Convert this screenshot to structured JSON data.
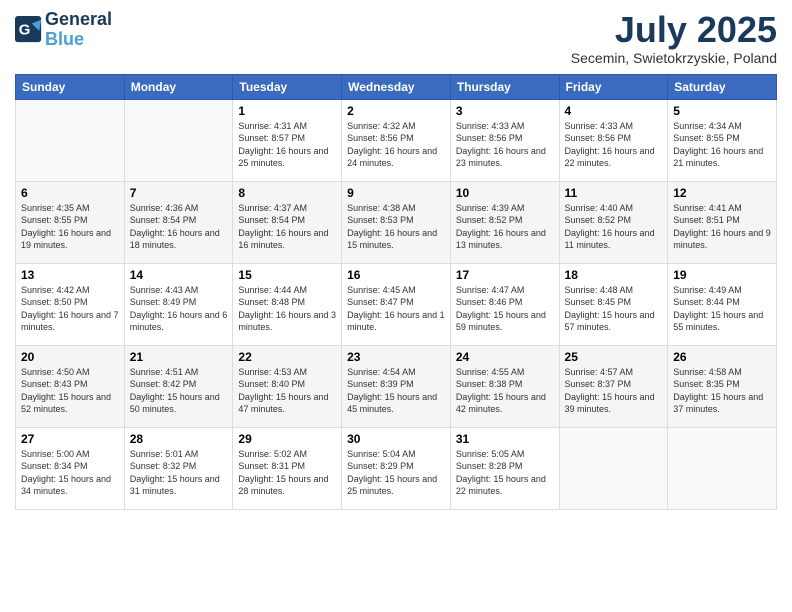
{
  "header": {
    "logo_line1": "General",
    "logo_line2": "Blue",
    "month_title": "July 2025",
    "subtitle": "Secemin, Swietokrzyskie, Poland"
  },
  "days_of_week": [
    "Sunday",
    "Monday",
    "Tuesday",
    "Wednesday",
    "Thursday",
    "Friday",
    "Saturday"
  ],
  "weeks": [
    [
      {
        "day": "",
        "sunrise": "",
        "sunset": "",
        "daylight": ""
      },
      {
        "day": "",
        "sunrise": "",
        "sunset": "",
        "daylight": ""
      },
      {
        "day": "1",
        "sunrise": "Sunrise: 4:31 AM",
        "sunset": "Sunset: 8:57 PM",
        "daylight": "Daylight: 16 hours and 25 minutes."
      },
      {
        "day": "2",
        "sunrise": "Sunrise: 4:32 AM",
        "sunset": "Sunset: 8:56 PM",
        "daylight": "Daylight: 16 hours and 24 minutes."
      },
      {
        "day": "3",
        "sunrise": "Sunrise: 4:33 AM",
        "sunset": "Sunset: 8:56 PM",
        "daylight": "Daylight: 16 hours and 23 minutes."
      },
      {
        "day": "4",
        "sunrise": "Sunrise: 4:33 AM",
        "sunset": "Sunset: 8:56 PM",
        "daylight": "Daylight: 16 hours and 22 minutes."
      },
      {
        "day": "5",
        "sunrise": "Sunrise: 4:34 AM",
        "sunset": "Sunset: 8:55 PM",
        "daylight": "Daylight: 16 hours and 21 minutes."
      }
    ],
    [
      {
        "day": "6",
        "sunrise": "Sunrise: 4:35 AM",
        "sunset": "Sunset: 8:55 PM",
        "daylight": "Daylight: 16 hours and 19 minutes."
      },
      {
        "day": "7",
        "sunrise": "Sunrise: 4:36 AM",
        "sunset": "Sunset: 8:54 PM",
        "daylight": "Daylight: 16 hours and 18 minutes."
      },
      {
        "day": "8",
        "sunrise": "Sunrise: 4:37 AM",
        "sunset": "Sunset: 8:54 PM",
        "daylight": "Daylight: 16 hours and 16 minutes."
      },
      {
        "day": "9",
        "sunrise": "Sunrise: 4:38 AM",
        "sunset": "Sunset: 8:53 PM",
        "daylight": "Daylight: 16 hours and 15 minutes."
      },
      {
        "day": "10",
        "sunrise": "Sunrise: 4:39 AM",
        "sunset": "Sunset: 8:52 PM",
        "daylight": "Daylight: 16 hours and 13 minutes."
      },
      {
        "day": "11",
        "sunrise": "Sunrise: 4:40 AM",
        "sunset": "Sunset: 8:52 PM",
        "daylight": "Daylight: 16 hours and 11 minutes."
      },
      {
        "day": "12",
        "sunrise": "Sunrise: 4:41 AM",
        "sunset": "Sunset: 8:51 PM",
        "daylight": "Daylight: 16 hours and 9 minutes."
      }
    ],
    [
      {
        "day": "13",
        "sunrise": "Sunrise: 4:42 AM",
        "sunset": "Sunset: 8:50 PM",
        "daylight": "Daylight: 16 hours and 7 minutes."
      },
      {
        "day": "14",
        "sunrise": "Sunrise: 4:43 AM",
        "sunset": "Sunset: 8:49 PM",
        "daylight": "Daylight: 16 hours and 6 minutes."
      },
      {
        "day": "15",
        "sunrise": "Sunrise: 4:44 AM",
        "sunset": "Sunset: 8:48 PM",
        "daylight": "Daylight: 16 hours and 3 minutes."
      },
      {
        "day": "16",
        "sunrise": "Sunrise: 4:45 AM",
        "sunset": "Sunset: 8:47 PM",
        "daylight": "Daylight: 16 hours and 1 minute."
      },
      {
        "day": "17",
        "sunrise": "Sunrise: 4:47 AM",
        "sunset": "Sunset: 8:46 PM",
        "daylight": "Daylight: 15 hours and 59 minutes."
      },
      {
        "day": "18",
        "sunrise": "Sunrise: 4:48 AM",
        "sunset": "Sunset: 8:45 PM",
        "daylight": "Daylight: 15 hours and 57 minutes."
      },
      {
        "day": "19",
        "sunrise": "Sunrise: 4:49 AM",
        "sunset": "Sunset: 8:44 PM",
        "daylight": "Daylight: 15 hours and 55 minutes."
      }
    ],
    [
      {
        "day": "20",
        "sunrise": "Sunrise: 4:50 AM",
        "sunset": "Sunset: 8:43 PM",
        "daylight": "Daylight: 15 hours and 52 minutes."
      },
      {
        "day": "21",
        "sunrise": "Sunrise: 4:51 AM",
        "sunset": "Sunset: 8:42 PM",
        "daylight": "Daylight: 15 hours and 50 minutes."
      },
      {
        "day": "22",
        "sunrise": "Sunrise: 4:53 AM",
        "sunset": "Sunset: 8:40 PM",
        "daylight": "Daylight: 15 hours and 47 minutes."
      },
      {
        "day": "23",
        "sunrise": "Sunrise: 4:54 AM",
        "sunset": "Sunset: 8:39 PM",
        "daylight": "Daylight: 15 hours and 45 minutes."
      },
      {
        "day": "24",
        "sunrise": "Sunrise: 4:55 AM",
        "sunset": "Sunset: 8:38 PM",
        "daylight": "Daylight: 15 hours and 42 minutes."
      },
      {
        "day": "25",
        "sunrise": "Sunrise: 4:57 AM",
        "sunset": "Sunset: 8:37 PM",
        "daylight": "Daylight: 15 hours and 39 minutes."
      },
      {
        "day": "26",
        "sunrise": "Sunrise: 4:58 AM",
        "sunset": "Sunset: 8:35 PM",
        "daylight": "Daylight: 15 hours and 37 minutes."
      }
    ],
    [
      {
        "day": "27",
        "sunrise": "Sunrise: 5:00 AM",
        "sunset": "Sunset: 8:34 PM",
        "daylight": "Daylight: 15 hours and 34 minutes."
      },
      {
        "day": "28",
        "sunrise": "Sunrise: 5:01 AM",
        "sunset": "Sunset: 8:32 PM",
        "daylight": "Daylight: 15 hours and 31 minutes."
      },
      {
        "day": "29",
        "sunrise": "Sunrise: 5:02 AM",
        "sunset": "Sunset: 8:31 PM",
        "daylight": "Daylight: 15 hours and 28 minutes."
      },
      {
        "day": "30",
        "sunrise": "Sunrise: 5:04 AM",
        "sunset": "Sunset: 8:29 PM",
        "daylight": "Daylight: 15 hours and 25 minutes."
      },
      {
        "day": "31",
        "sunrise": "Sunrise: 5:05 AM",
        "sunset": "Sunset: 8:28 PM",
        "daylight": "Daylight: 15 hours and 22 minutes."
      },
      {
        "day": "",
        "sunrise": "",
        "sunset": "",
        "daylight": ""
      },
      {
        "day": "",
        "sunrise": "",
        "sunset": "",
        "daylight": ""
      }
    ]
  ]
}
